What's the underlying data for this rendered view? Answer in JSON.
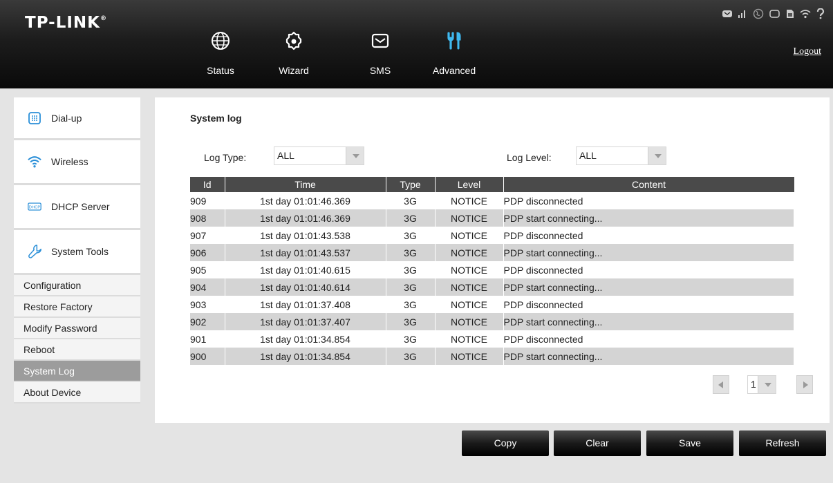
{
  "header": {
    "logo": "TP-LINK",
    "logo_mark": "®",
    "logout": "Logout",
    "nav": [
      {
        "label": "Status",
        "icon": "globe-icon"
      },
      {
        "label": "Wizard",
        "icon": "gear-icon"
      },
      {
        "label": "SMS",
        "icon": "envelope-icon"
      },
      {
        "label": "Advanced",
        "icon": "tools-icon"
      }
    ],
    "status_icons": [
      "sms-icon",
      "signal-icon",
      "internet-icon",
      "battery-icon",
      "sim-card-icon",
      "wifi-icon",
      "help-icon"
    ],
    "active_nav_color": "#3fb9f0"
  },
  "sidebar": {
    "main": [
      {
        "label": "Dial-up",
        "icon": "dialpad-icon"
      },
      {
        "label": "Wireless",
        "icon": "wireless-icon"
      },
      {
        "label": "DHCP Server",
        "icon": "dhcp-icon"
      },
      {
        "label": "System Tools",
        "icon": "wrench-icon"
      }
    ],
    "sub": [
      {
        "label": "Configuration"
      },
      {
        "label": "Restore Factory"
      },
      {
        "label": "Modify Password"
      },
      {
        "label": "Reboot"
      },
      {
        "label": "System Log",
        "active": true
      },
      {
        "label": "About Device"
      }
    ]
  },
  "main": {
    "title": "System log",
    "log_type_label": "Log Type:",
    "log_type_value": "ALL",
    "log_level_label": "Log Level:",
    "log_level_value": "ALL",
    "columns": [
      "Id",
      "Time",
      "Type",
      "Level",
      "Content"
    ],
    "rows": [
      [
        "909",
        "1st day 01:01:46.369",
        "3G",
        "NOTICE",
        "PDP disconnected"
      ],
      [
        "908",
        "1st day 01:01:46.369",
        "3G",
        "NOTICE",
        "PDP start connecting..."
      ],
      [
        "907",
        "1st day 01:01:43.538",
        "3G",
        "NOTICE",
        "PDP disconnected"
      ],
      [
        "906",
        "1st day 01:01:43.537",
        "3G",
        "NOTICE",
        "PDP start connecting..."
      ],
      [
        "905",
        "1st day 01:01:40.615",
        "3G",
        "NOTICE",
        "PDP disconnected"
      ],
      [
        "904",
        "1st day 01:01:40.614",
        "3G",
        "NOTICE",
        "PDP start connecting..."
      ],
      [
        "903",
        "1st day 01:01:37.408",
        "3G",
        "NOTICE",
        "PDP disconnected"
      ],
      [
        "902",
        "1st day 01:01:37.407",
        "3G",
        "NOTICE",
        "PDP start connecting..."
      ],
      [
        "901",
        "1st day 01:01:34.854",
        "3G",
        "NOTICE",
        "PDP disconnected"
      ],
      [
        "900",
        "1st day 01:01:34.854",
        "3G",
        "NOTICE",
        "PDP start connecting..."
      ]
    ],
    "page": "1"
  },
  "buttons": {
    "copy": "Copy",
    "clear": "Clear",
    "save": "Save",
    "refresh": "Refresh"
  }
}
